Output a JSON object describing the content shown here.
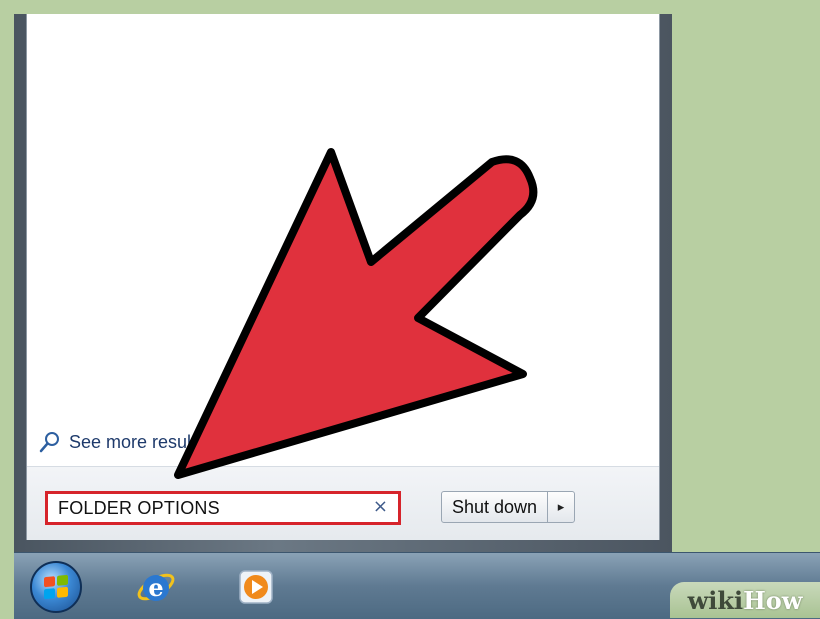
{
  "start_menu": {
    "see_more_label": "See more results",
    "search": {
      "value": "FOLDER OPTIONS",
      "clear_glyph": "×"
    },
    "shutdown": {
      "label": "Shut down",
      "arrow_glyph": "▸"
    }
  },
  "taskbar": {
    "icons": [
      "windows-start-orb-icon",
      "internet-explorer-icon",
      "windows-media-player-icon"
    ]
  },
  "watermark": {
    "wiki": "wiki",
    "how": "How"
  },
  "colors": {
    "arrow_red": "#e0313d",
    "search_highlight": "#d6242b",
    "desktop_green": "#b8cfa2",
    "taskbar_blue": "#5f7a92"
  }
}
